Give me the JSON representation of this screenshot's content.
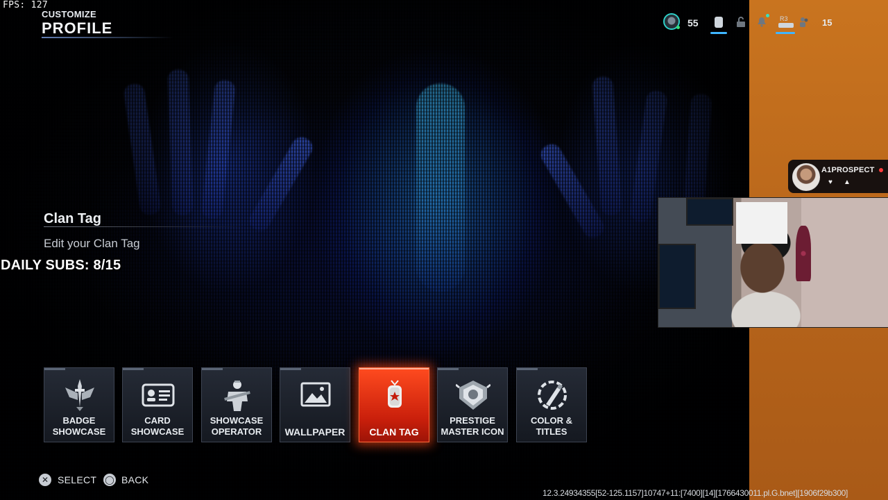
{
  "overlay": {
    "fps": "FPS: 127",
    "daily_subs": "DAILY SUBS: 8/15",
    "streamer_name": "A1PROSPECT"
  },
  "header": {
    "breadcrumb": "CUSTOMIZE",
    "title": "PROFILE"
  },
  "hud": {
    "player_level": "55",
    "friends_count": "15",
    "r3_hint": "R3",
    "icons": [
      "level-badge-icon",
      "phone-icon",
      "lock-icon",
      "bell-icon",
      "r3-icon",
      "friends-icon"
    ]
  },
  "description": {
    "title": "Clan Tag",
    "text": "Edit your Clan Tag"
  },
  "tiles": [
    {
      "label": "BADGE\nSHOWCASE",
      "icon": "badge-icon",
      "selected": false
    },
    {
      "label": "CARD\nSHOWCASE",
      "icon": "card-icon",
      "selected": false
    },
    {
      "label": "SHOWCASE\nOPERATOR",
      "icon": "operator-icon",
      "selected": false
    },
    {
      "label": "WALLPAPER",
      "icon": "wallpaper-icon",
      "selected": false
    },
    {
      "label": "CLAN TAG",
      "icon": "dog-tag-icon",
      "selected": true
    },
    {
      "label": "PRESTIGE\nMASTER ICON",
      "icon": "prestige-icon",
      "selected": false
    },
    {
      "label": "COLOR &\nTITLES",
      "icon": "color-titles-icon",
      "selected": false
    }
  ],
  "footer": {
    "select_glyph": "✕",
    "select_label": "SELECT",
    "back_glyph": "◯",
    "back_label": "BACK",
    "build_info": "12.3.24934355[52-125.1157]10747+11:[7400][14][1766430011.pl.G.bnet][1906f29b300]"
  },
  "colors": {
    "accent_selected": "#e5300f",
    "side_panel": "#c06b1c",
    "hud_accent": "#3fb6ff"
  }
}
